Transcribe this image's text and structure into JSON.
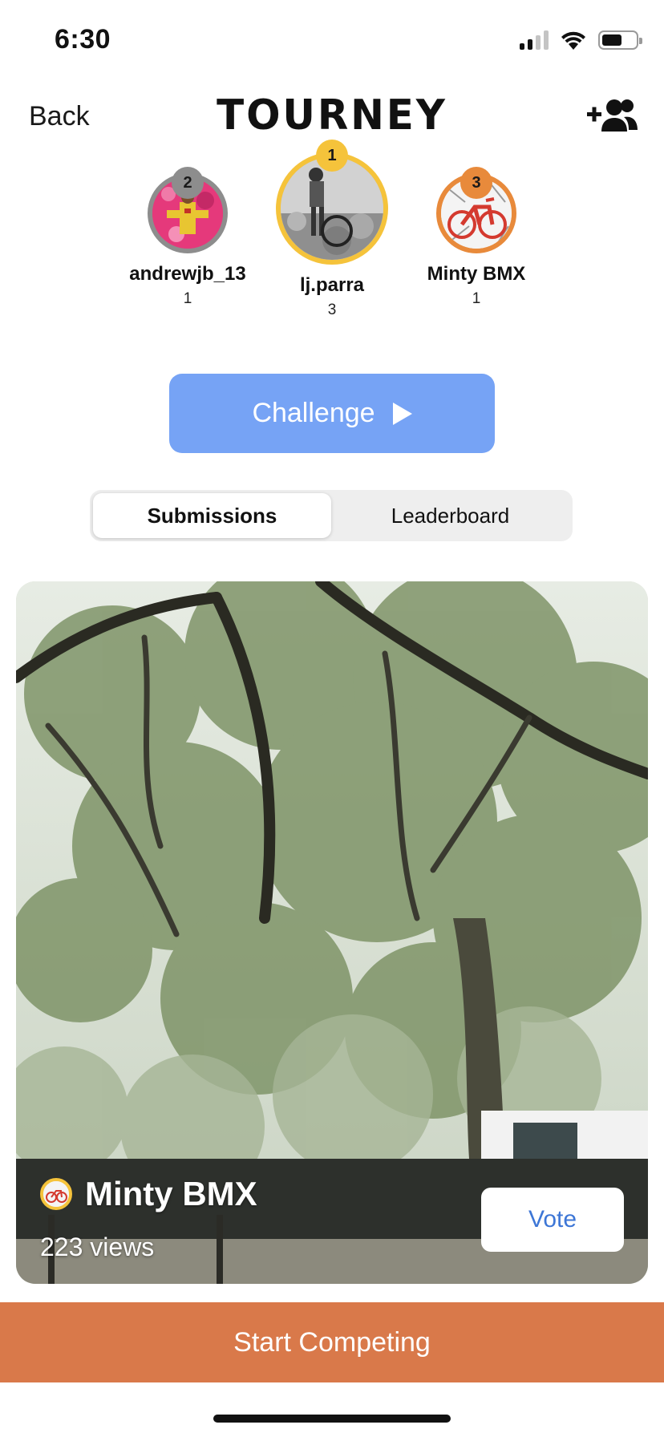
{
  "status_bar": {
    "time": "6:30",
    "icons": [
      "cellular-signal-icon",
      "wifi-icon",
      "battery-icon"
    ],
    "battery_level": 0.5
  },
  "nav": {
    "back_label": "Back",
    "title": "TOURNEY",
    "add_user_icon": "add-user-icon"
  },
  "podium": [
    {
      "rank": "1",
      "name": "lj.parra",
      "score": "3",
      "ring_color": "#f5c33b"
    },
    {
      "rank": "2",
      "name": "andrewjb_13",
      "score": "1",
      "ring_color": "#8d8d8d"
    },
    {
      "rank": "3",
      "name": "Minty BMX",
      "score": "1",
      "ring_color": "#e88a3b"
    }
  ],
  "challenge": {
    "label": "Challenge",
    "icon": "play-icon",
    "color": "#76a3f5"
  },
  "tabs": [
    {
      "label": "Submissions",
      "active": true
    },
    {
      "label": "Leaderboard",
      "active": false
    }
  ],
  "submission": {
    "user": "Minty BMX",
    "views": "223 views",
    "vote_label": "Vote"
  },
  "start_button": {
    "label": "Start Competing",
    "color": "#d9794a"
  }
}
